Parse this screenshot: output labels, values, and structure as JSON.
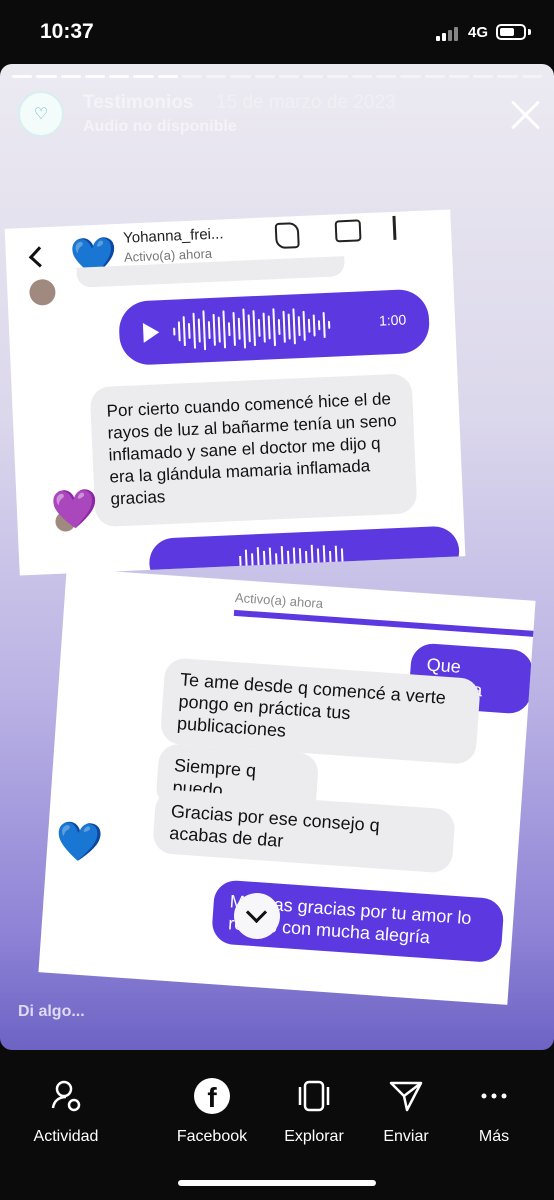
{
  "status": {
    "time": "10:37",
    "network": "4G"
  },
  "story": {
    "account": "Testimonios",
    "date": "15 de marzo de 2023",
    "audio_status": "Audio no disponible",
    "reply_placeholder": "Di algo..."
  },
  "card1": {
    "contact_name": "Yohanna_frei...",
    "active_status": "Activo(a) ahora",
    "voice_duration": "1:00",
    "message": "Por cierto cuando comencé hice el de rayos de luz al bañarme tenía un seno inflamado y sane el doctor me dijo q era la  glándula mamaria inflamada gracias"
  },
  "card2": {
    "active_status": "Activo(a) ahora",
    "my_message_1": "Que belleza",
    "their_message_1": "Te ame desde q comencé a verte pongo en práctica tus publicaciones",
    "their_message_2": "Siempre q puedo",
    "their_message_3": "Gracias por ese consejo q acabas de dar",
    "my_message_2": "Muchas gracias por tu amor lo recibo con mucha alegría"
  },
  "nav": [
    {
      "label": "Actividad",
      "icon": "activity-icon"
    },
    {
      "label": "Facebook",
      "icon": "facebook-icon"
    },
    {
      "label": "Explorar",
      "icon": "explore-icon"
    },
    {
      "label": "Enviar",
      "icon": "send-icon"
    },
    {
      "label": "Más",
      "icon": "more-icon"
    }
  ]
}
